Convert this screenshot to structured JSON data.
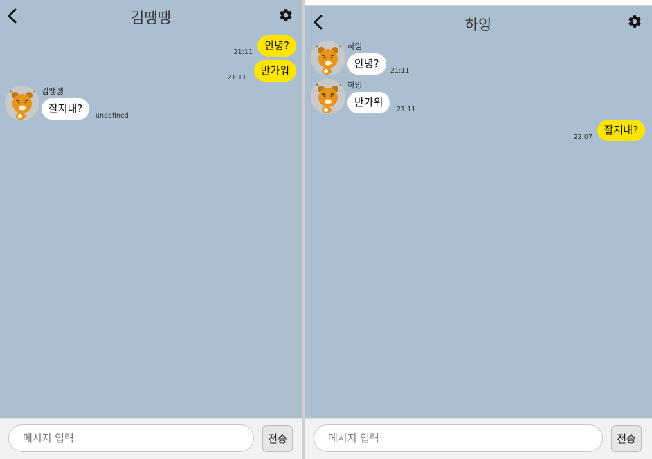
{
  "left_window": {
    "title": "김땡땡",
    "messages": [
      {
        "type": "mine",
        "text": "안녕?",
        "time": "21:11"
      },
      {
        "type": "mine",
        "text": "반가워",
        "time": "21:11"
      },
      {
        "type": "theirs",
        "sender": "김땡땡",
        "text": "잘지내?",
        "time": "undefined"
      }
    ],
    "input_placeholder": "메시지 입력",
    "send_label": "전송"
  },
  "right_window": {
    "title": "하잉",
    "messages": [
      {
        "type": "theirs",
        "sender": "하잉",
        "text": "안녕?",
        "time": "21:11"
      },
      {
        "type": "theirs",
        "sender": "하잉",
        "text": "반가워",
        "time": "21:11"
      },
      {
        "type": "mine",
        "text": "잘지내?",
        "time": "22:07"
      }
    ],
    "input_placeholder": "메시지 입력",
    "send_label": "전송"
  },
  "icons": {
    "back": "chevron-left-icon",
    "settings": "gear-icon",
    "avatar": "bear-avatar-icon"
  },
  "colors": {
    "chat_background": "#abbfd0",
    "my_bubble": "#fee500",
    "their_bubble": "#ffffff"
  }
}
